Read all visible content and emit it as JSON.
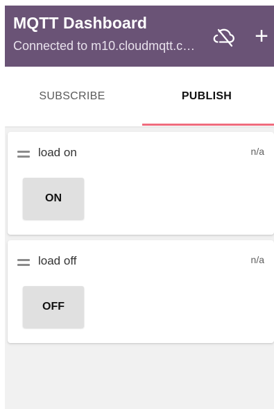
{
  "appbar": {
    "title": "MQTT Dashboard",
    "subtitle": "Connected to m10.cloudmqtt.co...",
    "icons": {
      "cloud_off": "cloud-off-icon",
      "add": "plus-icon"
    }
  },
  "tabs": [
    {
      "label": "SUBSCRIBE",
      "active": false
    },
    {
      "label": "PUBLISH",
      "active": true
    }
  ],
  "cards": [
    {
      "title": "load on",
      "status": "n/a",
      "button_label": "ON"
    },
    {
      "title": "load off",
      "status": "n/a",
      "button_label": "OFF"
    }
  ],
  "colors": {
    "appbar": "#6a5376",
    "accent": "#ef6b7d",
    "background": "#f1f1f1",
    "button": "#e0e0e0"
  }
}
